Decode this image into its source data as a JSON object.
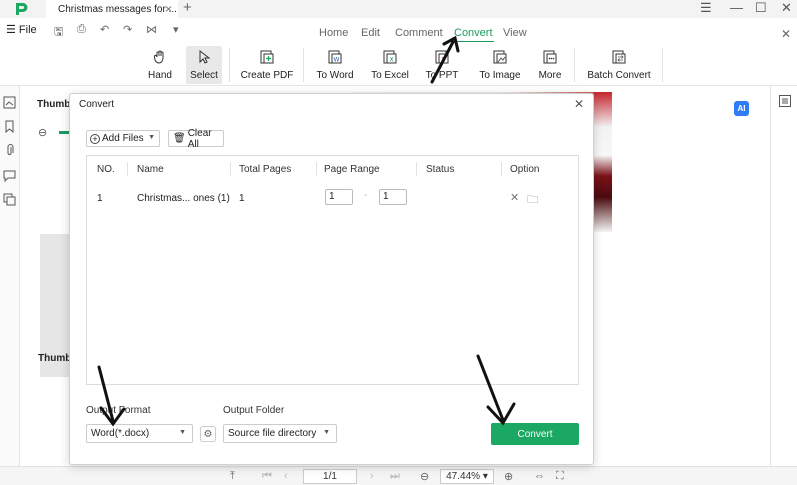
{
  "app": {
    "doc_tab_title": "Christmas messages for ..."
  },
  "menu": {
    "file_label": "File",
    "tabs": [
      {
        "label": "Home",
        "active": false
      },
      {
        "label": "Edit",
        "active": false
      },
      {
        "label": "Comment",
        "active": false
      },
      {
        "label": "Convert",
        "active": true
      },
      {
        "label": "View",
        "active": false
      }
    ]
  },
  "ribbon": {
    "buttons": [
      {
        "label": "Hand",
        "icon": "hand-icon"
      },
      {
        "label": "Select",
        "icon": "cursor-icon",
        "selected": true
      },
      {
        "label": "Create PDF",
        "icon": "create-pdf-icon"
      },
      {
        "label": "To Word",
        "icon": "word-icon"
      },
      {
        "label": "To Excel",
        "icon": "excel-icon"
      },
      {
        "label": "To PPT",
        "icon": "ppt-icon"
      },
      {
        "label": "To Image",
        "icon": "image-icon"
      },
      {
        "label": "More",
        "icon": "more-icon"
      },
      {
        "label": "Batch Convert",
        "icon": "batch-convert-icon"
      }
    ]
  },
  "sidebar": {
    "panel_title": "Thumb",
    "page_label": "Thumb"
  },
  "dialog": {
    "title": "Convert",
    "add_files_label": "Add Files",
    "clear_all_label": "Clear All",
    "columns": [
      "NO.",
      "Name",
      "Total Pages",
      "Page Range",
      "Status",
      "Option"
    ],
    "rows": [
      {
        "no": "1",
        "name": "Christmas... ones (1)",
        "total_pages": "1",
        "range_from": "1",
        "range_to": "1",
        "status": ""
      }
    ],
    "output_format_label": "Output Format",
    "output_format_value": "Word(*.docx)",
    "output_folder_label": "Output Folder",
    "output_folder_value": "Source file directory",
    "convert_label": "Convert"
  },
  "statusbar": {
    "page_indicator": "1/1",
    "zoom": "47.44%"
  },
  "colors": {
    "accent": "#1a9b61",
    "convert_button": "#1aa863",
    "ai_badge": "#2f7cf6"
  }
}
